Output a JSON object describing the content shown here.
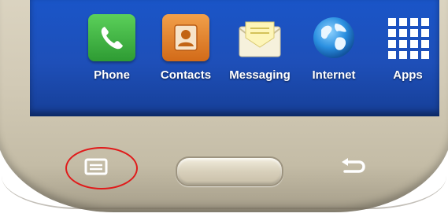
{
  "dock": {
    "apps": [
      {
        "label": "Phone",
        "icon": "phone-icon",
        "color": "#3bb33f"
      },
      {
        "label": "Contacts",
        "icon": "contacts-icon",
        "color": "#e07d25"
      },
      {
        "label": "Messaging",
        "icon": "envelope-icon",
        "color": "#f5f0d8"
      },
      {
        "label": "Internet",
        "icon": "globe-icon",
        "color": "#2a8fe0"
      },
      {
        "label": "Apps",
        "icon": "apps-grid-icon",
        "color": "#ffffff"
      }
    ]
  },
  "hardware_keys": {
    "menu": {
      "icon": "menu-key-icon",
      "highlighted": true,
      "highlight_color": "#e01b1b"
    },
    "home": {
      "icon": "home-button"
    },
    "back": {
      "icon": "back-arrow-icon"
    }
  }
}
